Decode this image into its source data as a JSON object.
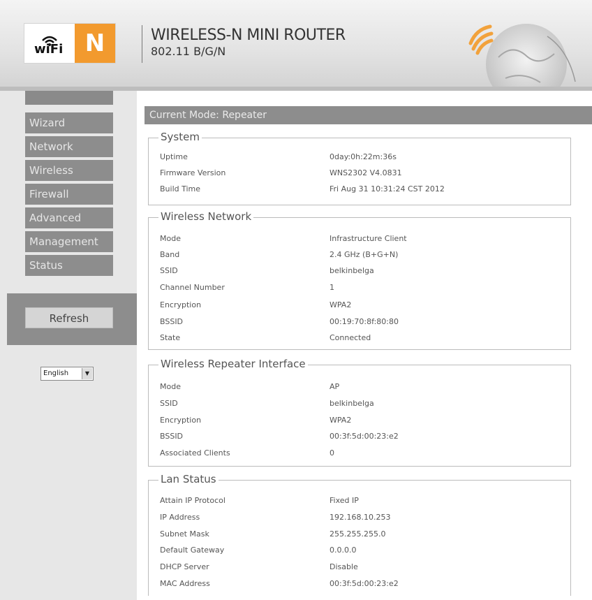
{
  "header": {
    "logo_text": "wiFi",
    "logo_letter": "N",
    "title": "WIRELESS-N MINI ROUTER",
    "subtitle": "802.11 B/G/N"
  },
  "sidebar": {
    "items": [
      {
        "label": "Wizard"
      },
      {
        "label": "Network"
      },
      {
        "label": "Wireless"
      },
      {
        "label": "Firewall"
      },
      {
        "label": "Advanced"
      },
      {
        "label": "Management"
      },
      {
        "label": "Status"
      }
    ],
    "refresh_label": "Refresh",
    "language": "English"
  },
  "mode_bar": "Current Mode:  Repeater",
  "sections": {
    "system": {
      "title": "System",
      "rows": [
        {
          "label": "Uptime",
          "value": "0day:0h:22m:36s"
        },
        {
          "label": "Firmware Version",
          "value": "WNS2302 V4.0831"
        },
        {
          "label": "Build Time",
          "value": "Fri Aug 31 10:31:24 CST 2012"
        }
      ]
    },
    "wireless": {
      "title": "Wireless Network",
      "rows": [
        {
          "label": "Mode",
          "value": "Infrastructure Client"
        },
        {
          "label": "Band",
          "value": "2.4 GHz (B+G+N)"
        },
        {
          "label": "SSID",
          "value": "belkinbelga"
        },
        {
          "label": "Channel Number",
          "value": "1"
        },
        {
          "label": "Encryption",
          "value": "WPA2"
        },
        {
          "label": "BSSID",
          "value": "00:19:70:8f:80:80"
        },
        {
          "label": "State",
          "value": "Connected"
        }
      ]
    },
    "repeater": {
      "title": "Wireless Repeater Interface",
      "rows": [
        {
          "label": "Mode",
          "value": "AP"
        },
        {
          "label": "SSID",
          "value": "belkinbelga"
        },
        {
          "label": "Encryption",
          "value": "WPA2"
        },
        {
          "label": "BSSID",
          "value": "00:3f:5d:00:23:e2"
        },
        {
          "label": "Associated Clients",
          "value": "0"
        }
      ]
    },
    "lan": {
      "title": "Lan Status",
      "rows": [
        {
          "label": "Attain IP Protocol",
          "value": "Fixed IP"
        },
        {
          "label": "IP Address",
          "value": "192.168.10.253"
        },
        {
          "label": "Subnet Mask",
          "value": "255.255.255.0"
        },
        {
          "label": "Default Gateway",
          "value": "0.0.0.0"
        },
        {
          "label": "DHCP Server",
          "value": "Disable"
        },
        {
          "label": "MAC Address",
          "value": "00:3f:5d:00:23:e2"
        }
      ]
    }
  },
  "colors": {
    "nav_bg": "#8d8d8d",
    "sidebar_bg": "#e7e7e7",
    "logo_accent": "#f29a2e"
  }
}
